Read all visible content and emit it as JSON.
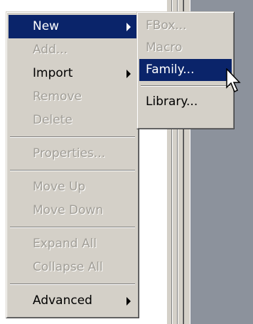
{
  "main_menu": {
    "items": [
      {
        "label": "New",
        "state": "highlighted",
        "submenu": true
      },
      {
        "label": "Add...",
        "state": "disabled"
      },
      {
        "label": "Import",
        "state": "enabled",
        "submenu": true
      },
      {
        "label": "Remove",
        "state": "disabled"
      },
      {
        "label": "Delete",
        "state": "disabled"
      },
      {
        "label": "Properties...",
        "state": "disabled"
      },
      {
        "label": "Move Up",
        "state": "disabled"
      },
      {
        "label": "Move Down",
        "state": "disabled"
      },
      {
        "label": "Expand All",
        "state": "disabled"
      },
      {
        "label": "Collapse All",
        "state": "disabled"
      },
      {
        "label": "Advanced",
        "state": "enabled",
        "submenu": true
      }
    ]
  },
  "sub_menu": {
    "items": [
      {
        "label": "FBox...",
        "state": "disabled"
      },
      {
        "label": "Macro",
        "state": "disabled"
      },
      {
        "label": "Family...",
        "state": "highlighted"
      },
      {
        "label": "Library...",
        "state": "enabled"
      }
    ]
  },
  "colors": {
    "menu_bg": "#d4d0c8",
    "highlight_bg": "#0a246a",
    "disabled_text": "#a19e97"
  },
  "icons": {
    "submenu_arrow": "chevron-right-icon",
    "pointer": "mouse-pointer-icon"
  }
}
